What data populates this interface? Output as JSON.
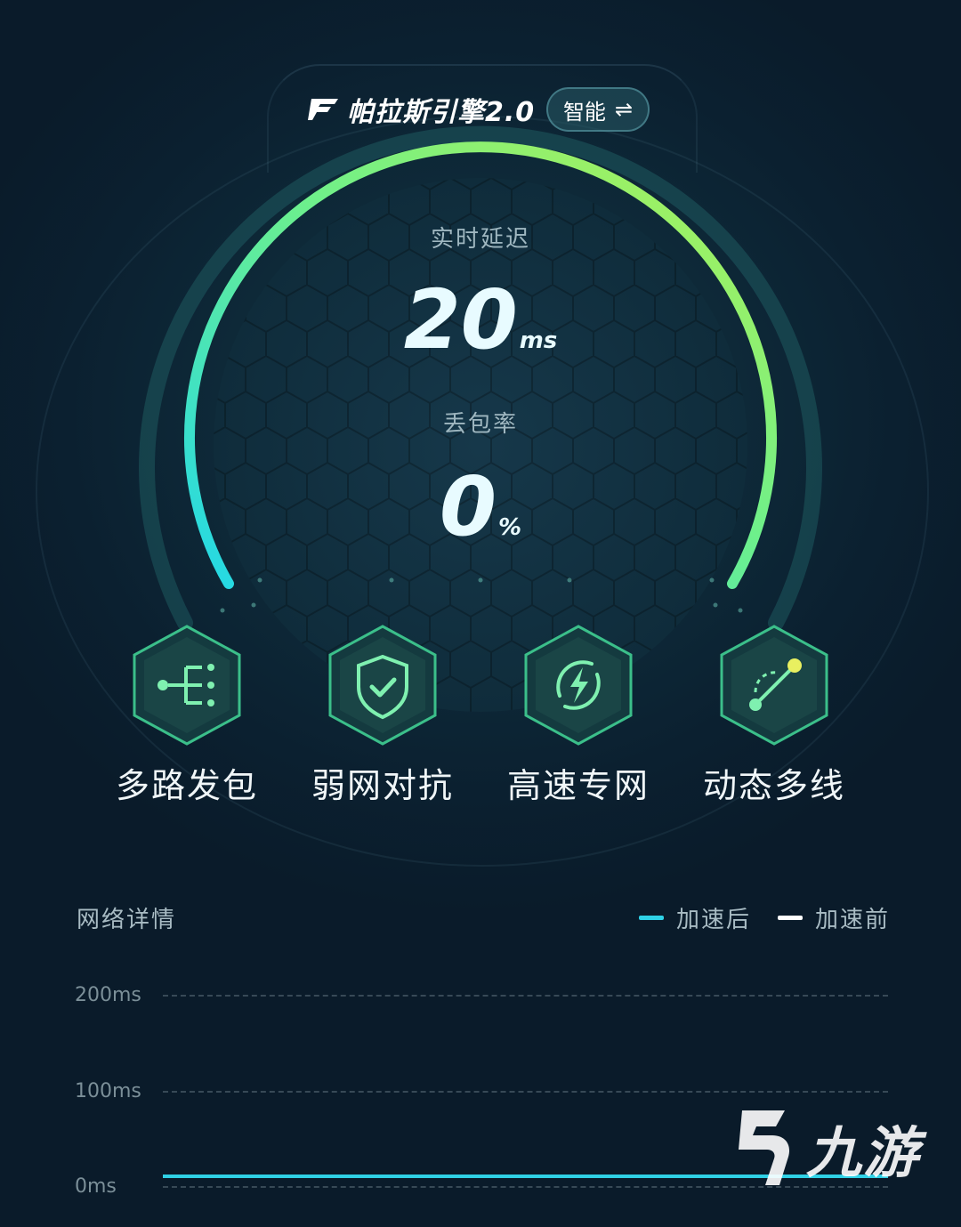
{
  "header": {
    "engine_name": "帕拉斯引擎2.0",
    "mode_label": "智能",
    "swap_icon": "⇌"
  },
  "gauge": {
    "latency_label": "实时延迟",
    "latency_value": "20",
    "latency_unit": "ms",
    "loss_label": "丢包率",
    "loss_value": "0",
    "loss_unit": "%"
  },
  "features": [
    {
      "label": "多路发包",
      "icon": "multipath-icon"
    },
    {
      "label": "弱网对抗",
      "icon": "shield-check-icon"
    },
    {
      "label": "高速专网",
      "icon": "lightning-icon"
    },
    {
      "label": "动态多线",
      "icon": "route-line-icon"
    }
  ],
  "network": {
    "title": "网络详情",
    "legend": [
      {
        "label": "加速后",
        "color": "#2fd1e6"
      },
      {
        "label": "加速前",
        "color": "#ffffff"
      }
    ],
    "y_ticks": [
      "200ms",
      "100ms",
      "0ms"
    ]
  },
  "colors": {
    "arc_start": "#22d8e8",
    "arc_end": "#a6f14e",
    "accent": "#2fd1e6"
  },
  "watermark": {
    "text": "九游"
  }
}
